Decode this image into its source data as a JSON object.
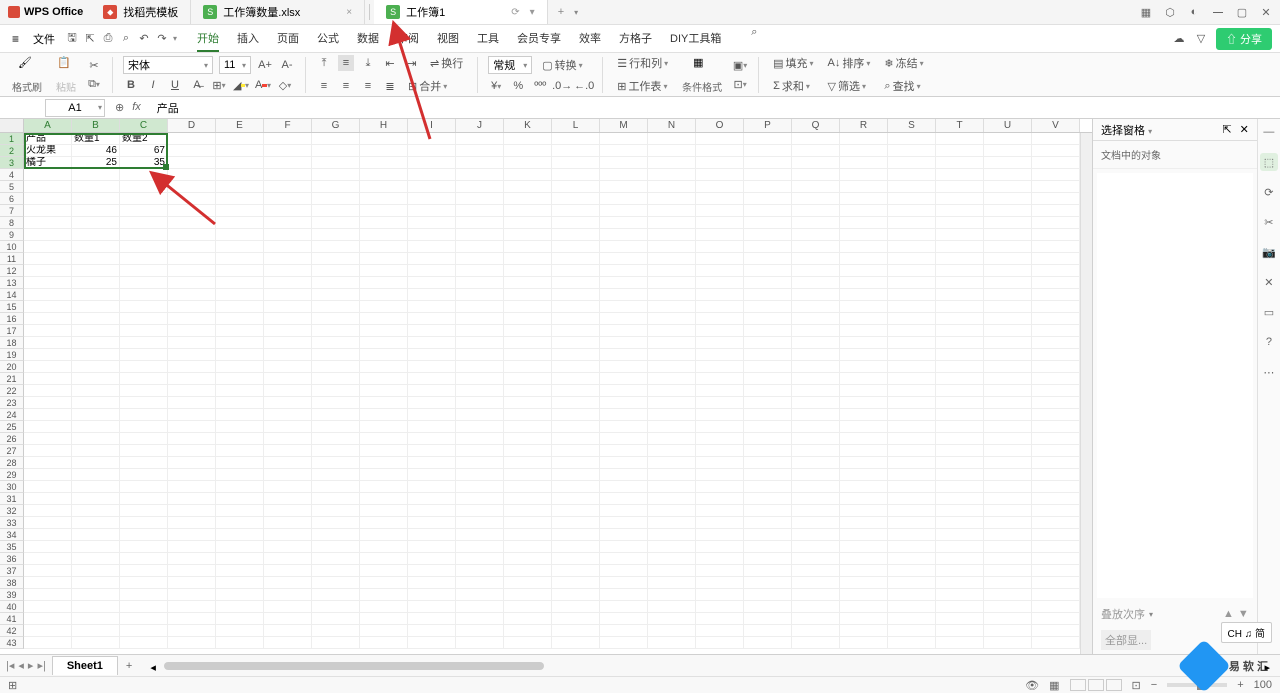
{
  "app": {
    "name": "WPS Office"
  },
  "tabs": [
    {
      "label": "找稻壳模板",
      "icon": "red"
    },
    {
      "label": "工作簿数量.xlsx",
      "icon": "green"
    },
    {
      "label": "工作簿1",
      "icon": "green",
      "active": true
    }
  ],
  "menu": {
    "file": "文件",
    "items": [
      "开始",
      "插入",
      "页面",
      "公式",
      "数据",
      "审阅",
      "视图",
      "工具",
      "会员专享",
      "效率",
      "方格子",
      "DIY工具箱"
    ],
    "active": "开始",
    "share": "分享"
  },
  "ribbon": {
    "format_painter": "格式刷",
    "paste": "粘贴",
    "font_name": "宋体",
    "font_size": "11",
    "bold": "B",
    "italic": "I",
    "underline": "U",
    "strike": "S",
    "wrap": "换行",
    "merge": "合并",
    "number_format": "常规",
    "convert": "转换",
    "rowcol": "行和列",
    "worksheet": "工作表",
    "cond_format": "条件格式",
    "fill": "填充",
    "sort": "排序",
    "freeze": "冻结",
    "sum": "求和",
    "filter": "筛选",
    "find": "查找"
  },
  "formula_bar": {
    "name_box": "A1",
    "value": "产品"
  },
  "columns": [
    "A",
    "B",
    "C",
    "D",
    "E",
    "F",
    "G",
    "H",
    "I",
    "J",
    "K",
    "L",
    "M",
    "N",
    "O",
    "P",
    "Q",
    "R",
    "S",
    "T",
    "U",
    "V"
  ],
  "selected_cols": [
    "A",
    "B",
    "C"
  ],
  "data_rows": [
    {
      "A": "产品",
      "B": "数量1",
      "C": "数量2"
    },
    {
      "A": "火龙果",
      "B": "46",
      "C": "67"
    },
    {
      "A": "橘子",
      "B": "25",
      "C": "35"
    }
  ],
  "sheet": {
    "name": "Sheet1"
  },
  "side_panel": {
    "title": "选择窗格",
    "sub": "文档中的对象",
    "footer": "全部显...",
    "layer": "叠放次序"
  },
  "status": {
    "zoom": "100",
    "ime": "CH ♫ 简"
  },
  "watermark": "易 软 汇"
}
